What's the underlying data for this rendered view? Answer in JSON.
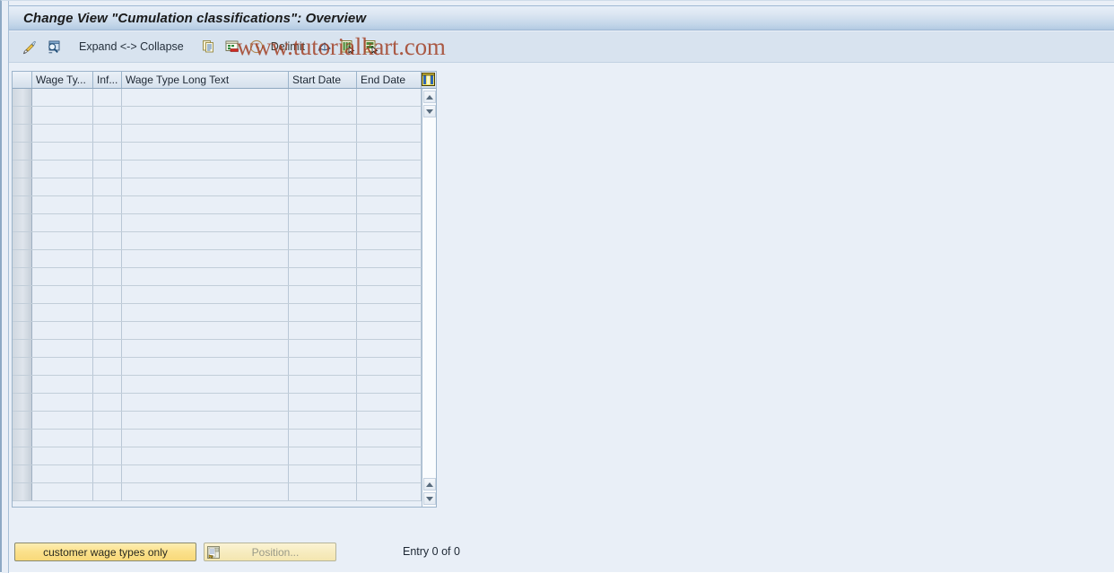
{
  "window": {
    "title": "Change View \"Cumulation classifications\": Overview"
  },
  "watermark": {
    "text": "www.tutorialkart.com",
    "color": "#a03b1f"
  },
  "toolbar": {
    "items": [
      {
        "name": "change-pencil-icon",
        "label": "",
        "icon": "pencil-icon"
      },
      {
        "name": "display-magnifier-icon",
        "label": "",
        "icon": "magnifier-icon"
      },
      {
        "name": "expand-collapse-button",
        "label": "Expand <-> Collapse",
        "icon": ""
      },
      {
        "name": "copy-icon",
        "label": "",
        "icon": "copy-as-icon"
      },
      {
        "name": "delete-icon",
        "label": "",
        "icon": "delete-row-icon"
      },
      {
        "name": "delimit-button",
        "label": "Delimit",
        "icon": "clock-icon"
      },
      {
        "name": "undo-icon",
        "label": "",
        "icon": "undo-arrow-icon"
      },
      {
        "name": "select-all-icon",
        "label": "",
        "icon": "select-all-icon"
      },
      {
        "name": "deselect-all-icon",
        "label": "",
        "icon": "deselect-all-icon"
      }
    ],
    "expand_collapse_label": "Expand <-> Collapse",
    "delimit_label": "Delimit"
  },
  "table": {
    "columns": [
      {
        "key": "select",
        "label": ""
      },
      {
        "key": "wage_type",
        "label": "Wage Ty..."
      },
      {
        "key": "infotype",
        "label": "Inf..."
      },
      {
        "key": "wage_type_long_text",
        "label": "Wage Type Long Text"
      },
      {
        "key": "start_date",
        "label": "Start Date"
      },
      {
        "key": "end_date",
        "label": "End Date"
      }
    ],
    "config_icon": "table-settings-icon",
    "rows": [],
    "empty_row_count": 23,
    "scrollbar": {
      "up_top": "scroll-up",
      "down_top": "scroll-down",
      "up_bottom": "scroll-up",
      "down_bottom": "scroll-down"
    }
  },
  "footer": {
    "customer_wage_types_label": "customer wage types only",
    "position_label": "Position...",
    "position_icon": "position-icon",
    "entry_count": "Entry 0 of 0"
  }
}
